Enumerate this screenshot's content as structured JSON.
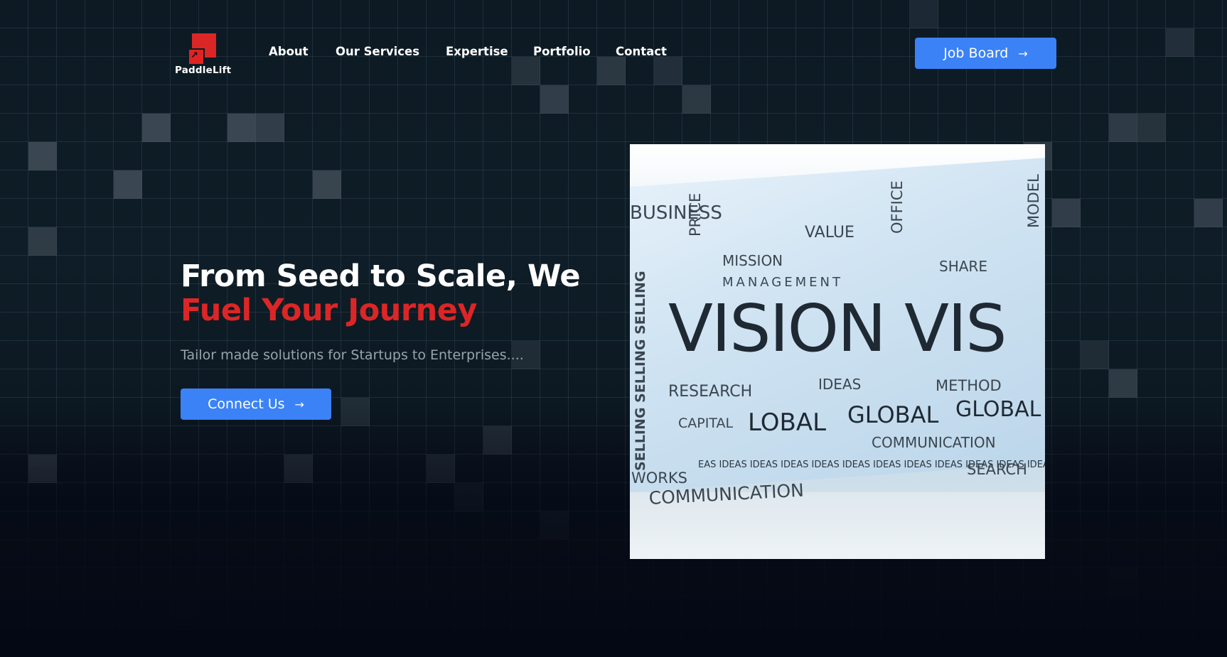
{
  "brand": {
    "name": "PaddleLift",
    "accent": "#dc2626",
    "primary": "#3b82f6"
  },
  "nav": {
    "items": [
      "About",
      "Our Services",
      "Expertise",
      "Portfolio",
      "Contact"
    ]
  },
  "header": {
    "job_board_label": "Job Board",
    "job_board_icon": "arrow-right-icon"
  },
  "hero": {
    "title_line1": "From Seed to Scale, We",
    "title_line2": "Fuel Your Journey",
    "subtitle": "Tailor made solutions for Startups to Enterprises....",
    "cta_label": "Connect Us",
    "cta_icon": "arrow-right-icon"
  },
  "hero_image": {
    "words": [
      "BUSINESS",
      "VALUE",
      "PRICE",
      "MISSION",
      "MANAGEMENT",
      "OFFICE",
      "SHARE",
      "MODEL",
      "SELLING SELLING SELLING",
      "VISION VIS",
      "RESEARCH",
      "IDEAS",
      "METHOD",
      "CAPITAL",
      "LOBAL",
      "GLOBAL",
      "GLOBAL",
      "COMMUNICATION",
      "WORKS",
      "EAS IDEAS IDEAS IDEAS IDEAS IDEAS IDEAS IDEAS IDEAS IDEAS IDEAS IDEAS IDEAS I",
      "SEARCH",
      "COMMUNICATION"
    ]
  }
}
